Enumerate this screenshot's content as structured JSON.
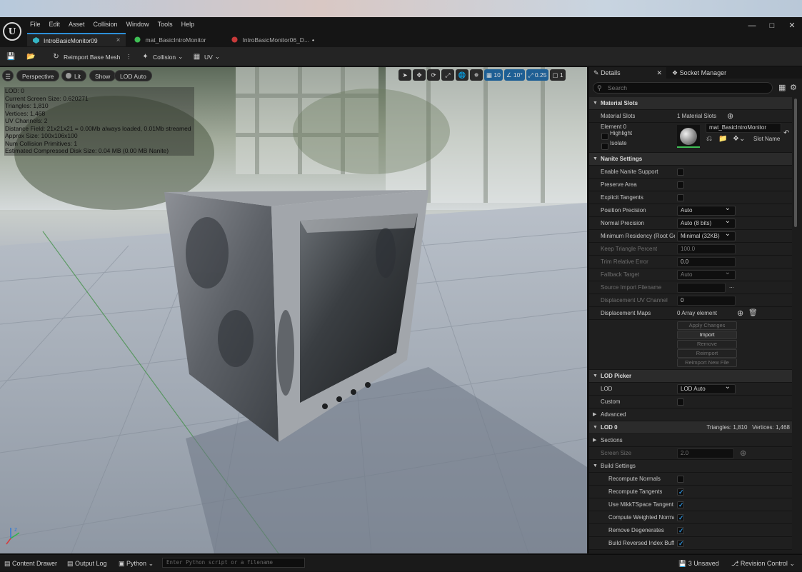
{
  "app": {
    "title": "Unreal Editor - Static Mesh Editor"
  },
  "menu": [
    "File",
    "Edit",
    "Asset",
    "Collision",
    "Window",
    "Tools",
    "Help"
  ],
  "tabs": [
    {
      "label": "IntroBasicMonitor09",
      "active": true,
      "close": "×"
    },
    {
      "label": "mat_BasicIntroMonitor",
      "active": false,
      "close": ""
    },
    {
      "label": "IntroBasicMonitor06_D...",
      "active": false,
      "close": "•"
    }
  ],
  "toolbar": {
    "reimport": "Reimport Base Mesh",
    "collision": "Collision",
    "uv": "UV"
  },
  "viewport": {
    "perspective": "Perspective",
    "lit": "Lit",
    "show": "Show",
    "lod": "LOD Auto",
    "stats": [
      "LOD:  0",
      "Current Screen Size:  0.620271",
      "Triangles:  1,810",
      "Vertices:  1,468",
      "UV Channels:  2",
      "Distance Field:  21x21x21 = 0.00Mb always loaded, 0.01Mb streamed",
      "Approx Size: 100x106x100",
      "Num Collision Primitives:  1",
      "Estimated Compressed Disk Size: 0.04 MB (0.00 MB Nanite)"
    ],
    "grid_size": "10",
    "rot_snap": "10°",
    "scale_snap": "0.25",
    "cam_speed": "1"
  },
  "details": {
    "tab_details": "Details",
    "tab_socket": "Socket Manager",
    "search_placeholder": "Search",
    "material_slots_header": "Material Slots",
    "material_slots_label": "Material Slots",
    "material_slots_value": "1 Material Slots",
    "element0": "Element 0",
    "highlight": "Highlight",
    "isolate": "Isolate",
    "material_name": "mat_BasicIntroMonitor",
    "slot_name": "Slot Name",
    "nanite_header": "Nanite Settings",
    "enable_nanite": "Enable Nanite Support",
    "preserve_area": "Preserve Area",
    "explicit_tangents": "Explicit Tangents",
    "position_precision": "Position Precision",
    "position_precision_value": "Auto",
    "normal_precision": "Normal Precision",
    "normal_precision_value": "Auto (8 bits)",
    "min_residency": "Minimum Residency (Root Geome",
    "min_residency_value": "Minimal (32KB)",
    "keep_triangle": "Keep Triangle Percent",
    "keep_triangle_value": "100.0",
    "trim_error": "Trim Relative Error",
    "trim_error_value": "0.0",
    "fallback_target": "Fallback Target",
    "fallback_target_value": "Auto",
    "source_import": "Source Import Filename",
    "source_import_dots": "...",
    "displacement_uv": "Displacement UV Channel",
    "displacement_uv_value": "0",
    "displacement_maps": "Displacement Maps",
    "displacement_maps_value": "0 Array element",
    "btn_apply": "Apply Changes",
    "btn_import": "Import",
    "btn_remove": "Remove",
    "btn_reimport": "Reimport",
    "btn_reimport_new": "Reimport New File",
    "lod_picker_header": "LOD Picker",
    "lod": "LOD",
    "lod_value": "LOD Auto",
    "custom": "Custom",
    "advanced": "Advanced",
    "lod0_header": "LOD 0",
    "lod0_stats": "Triangles: 1,810   Vertices: 1,468",
    "sections": "Sections",
    "screen_size": "Screen Size",
    "screen_size_value": "2.0",
    "build_settings": "Build Settings",
    "recompute_normals": "Recompute Normals",
    "recompute_tangents": "Recompute Tangents",
    "use_mikk": "Use MikkTSpace Tangent",
    "compute_weighted": "Compute Weighted Norma",
    "remove_degenerates": "Remove Degenerates",
    "build_reversed": "Build Reversed Index Buff"
  },
  "status": {
    "content_drawer": "Content Drawer",
    "output_log": "Output Log",
    "python": "Python",
    "python_placeholder": "Enter Python script or a filename",
    "unsaved": "3 Unsaved",
    "revision_control": "Revision Control"
  },
  "colors": {
    "accent": "#2d8fd8",
    "panel": "#1c1c1c",
    "toolbar": "#242424"
  }
}
